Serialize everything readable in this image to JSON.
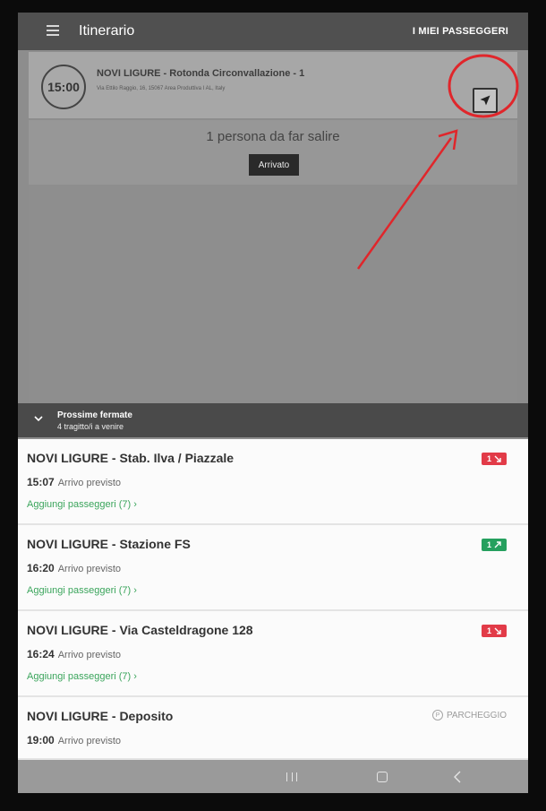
{
  "appbar": {
    "title": "Itinerario",
    "passengers_link": "I MIEI PASSEGGERI"
  },
  "current_stop": {
    "time": "15:00",
    "name": "NOVI LIGURE - Rotonda Circonvallazione - 1",
    "address": "Via Ettilo Raggio, 16, 15067 Area Produttiva I AL, Italy"
  },
  "pickup": {
    "text": "1 persona da far salire",
    "arrived_label": "Arrivato"
  },
  "next_stops": {
    "title": "Prossime fermate",
    "subtitle": "4 tragitto/i a venire",
    "items": [
      {
        "name": "NOVI LIGURE - Stab. Ilva / Piazzale",
        "time": "15:07",
        "expected": "Arrivo previsto",
        "add_passengers": "Aggiungi passeggeri (7)  ›",
        "badge": "1",
        "badge_type": "down",
        "badge_color": "#e23b48"
      },
      {
        "name": "NOVI LIGURE - Stazione FS",
        "time": "16:20",
        "expected": "Arrivo previsto",
        "add_passengers": "Aggiungi passeggeri (7)  ›",
        "badge": "1",
        "badge_type": "up",
        "badge_color": "#25a05e"
      },
      {
        "name": "NOVI LIGURE - Via Casteldragone 128",
        "time": "16:24",
        "expected": "Arrivo previsto",
        "add_passengers": "Aggiungi passeggeri (7)  ›",
        "badge": "1",
        "badge_type": "down",
        "badge_color": "#e23b48"
      },
      {
        "name": "NOVI LIGURE - Deposito",
        "time": "19:00",
        "expected": "Arrivo previsto",
        "tag": "PARCHEGGIO"
      }
    ]
  },
  "icons": {
    "menu": "hamburger-icon",
    "navigate": "navigation-arrow-icon",
    "collapse": "chevron-down-icon",
    "parking": "parking-icon"
  },
  "colors": {
    "accent_green": "#3ba55c",
    "annotation_red": "#e0262b"
  }
}
